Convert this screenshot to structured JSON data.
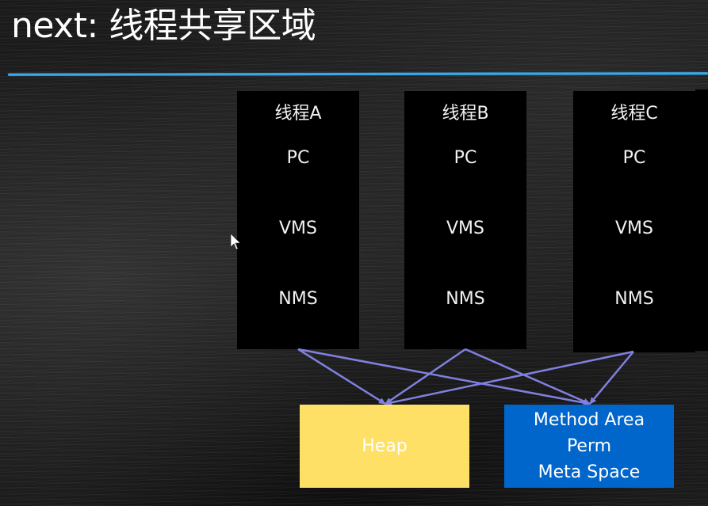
{
  "slide": {
    "title": "next: 线程共享区域",
    "accent_color": "#3aa8e8"
  },
  "threads": [
    {
      "name": "线程A",
      "items": [
        "PC",
        "VMS",
        "NMS"
      ]
    },
    {
      "name": "线程B",
      "items": [
        "PC",
        "VMS",
        "NMS"
      ]
    },
    {
      "name": "线程C",
      "items": [
        "PC",
        "VMS",
        "NMS"
      ]
    }
  ],
  "shared_areas": {
    "heap": {
      "label": "Heap",
      "color": "#ffe066"
    },
    "method_area": {
      "lines": [
        "Method Area",
        "Perm",
        "Meta Space"
      ],
      "color": "#0066cc"
    }
  },
  "connections": [
    {
      "from": "线程A",
      "to": "Heap"
    },
    {
      "from": "线程A",
      "to": "Method Area"
    },
    {
      "from": "线程B",
      "to": "Heap"
    },
    {
      "from": "线程B",
      "to": "Method Area"
    },
    {
      "from": "线程C",
      "to": "Heap"
    },
    {
      "from": "线程C",
      "to": "Method Area"
    }
  ],
  "arrow_color": "#8080e0"
}
